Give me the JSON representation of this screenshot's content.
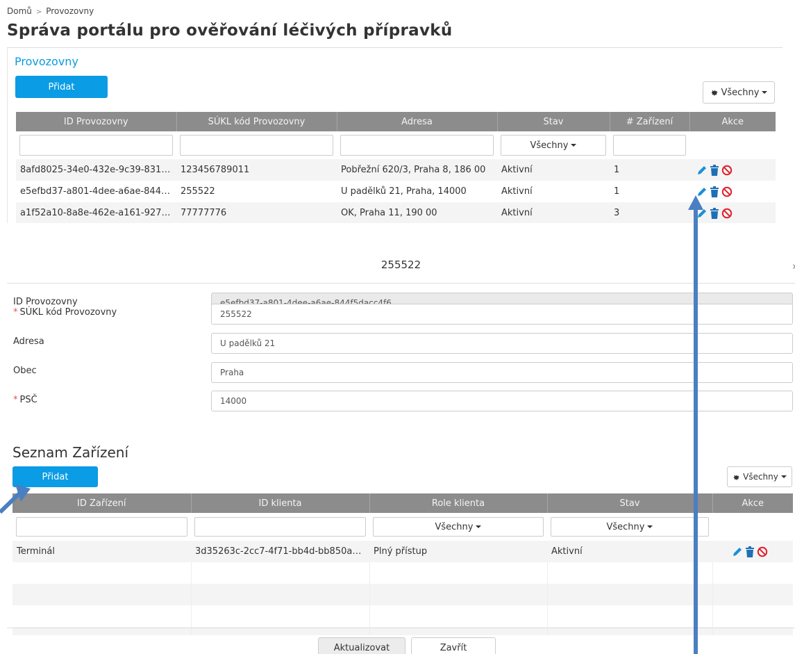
{
  "breadcrumb": {
    "home": "Domů",
    "separator": ">",
    "current": "Provozovny"
  },
  "page_title": "Správa portálu pro ověřování léčivých přípravků",
  "provozovny": {
    "title": "Provozovny",
    "add_label": "Přidat",
    "columns_label": "Všechny",
    "headers": [
      "ID Provozovny",
      "SÚKL kód Provozovny",
      "Adresa",
      "Stav",
      "# Zařízení",
      "Akce"
    ],
    "stav_filter": "Všechny",
    "rows": [
      {
        "id": "8afd8025-34e0-432e-9c39-831eb...",
        "sukl": "123456789011",
        "adresa": "Pobřežní 620/3, Praha 8, 186 00",
        "stav": "Aktivní",
        "count": "1"
      },
      {
        "id": "e5efbd37-a801-4dee-a6ae-844f5d...",
        "sukl": "255522",
        "adresa": "U padělků 21, Praha, 14000",
        "stav": "Aktivní",
        "count": "1"
      },
      {
        "id": "a1f52a10-8a8e-462e-a161-9273cc...",
        "sukl": "77777776",
        "adresa": "OK, Praha 11, 190 00",
        "stav": "Aktivní",
        "count": "3"
      }
    ]
  },
  "detail": {
    "title": "255522",
    "close": "›",
    "fields": {
      "id": {
        "label": "ID Provozovny",
        "value": "e5efbd37-a801-4dee-a6ae-844f5dacc4f6"
      },
      "sukl": {
        "label": "SÚKL kód Provozovny",
        "value": "255522"
      },
      "adresa": {
        "label": "Adresa",
        "value": "U padělků 21"
      },
      "obec": {
        "label": "Obec",
        "value": "Praha"
      },
      "psc": {
        "label": "PSČ",
        "value": "14000"
      }
    },
    "required_mark": "*",
    "devices": {
      "title": "Seznam Zařízení",
      "add_label": "Přidat",
      "columns_label": "Všechny",
      "headers": [
        "ID Zařízení",
        "ID klienta",
        "Role klienta",
        "Stav",
        "Akce"
      ],
      "role_filter": "Všechny",
      "stav_filter": "Všechny",
      "rows": [
        {
          "id": "Terminál",
          "client": "3d35263c-2cc7-4f71-bb4d-bb850a1e0253",
          "role": "Plný přístup",
          "stav": "Aktivní"
        }
      ]
    },
    "update_label": "Aktualizovat",
    "close_label": "Zavřít"
  },
  "colors": {
    "accent": "#0a9ce4",
    "header_bg": "#8c8c8c",
    "edit_icon": "#1a8fd8",
    "delete_icon": "#1f6fb5",
    "block_icon": "#e0202a",
    "arrow": "#4a7fc1"
  }
}
